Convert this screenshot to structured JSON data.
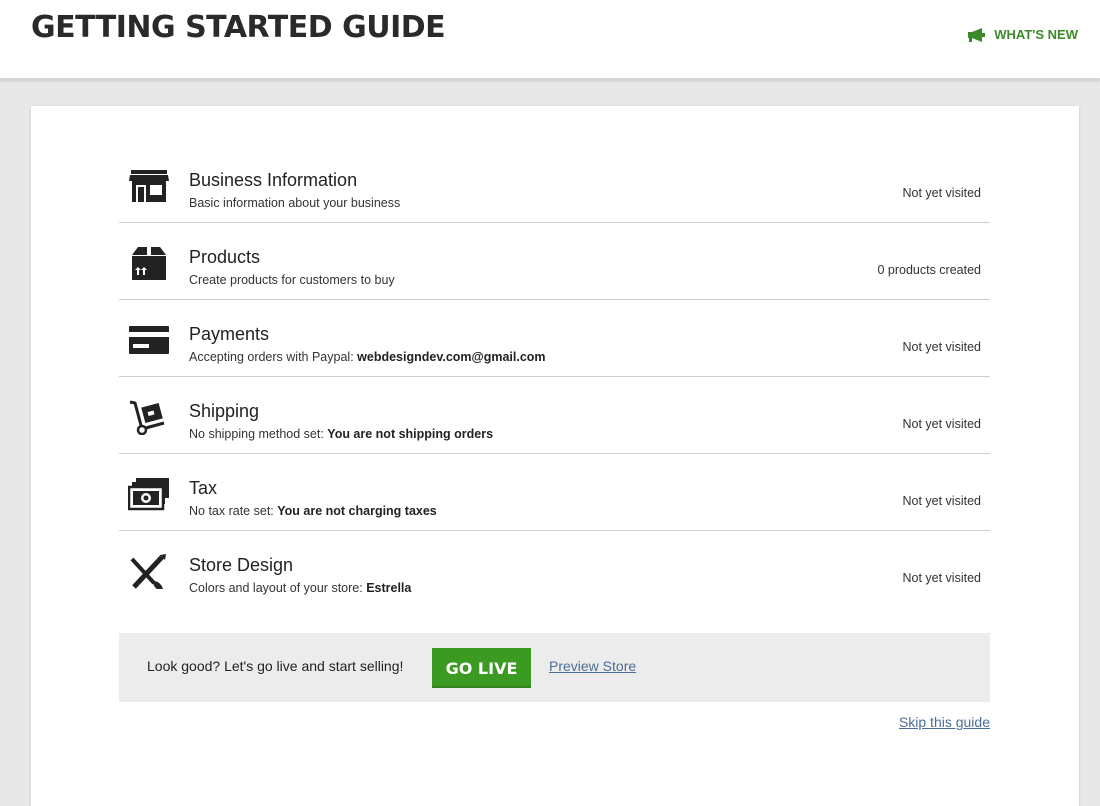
{
  "header": {
    "title": "GETTING STARTED GUIDE",
    "whats_new": "WHAT'S NEW"
  },
  "steps": [
    {
      "title": "Business Information",
      "desc": "Basic information about your business",
      "desc_bold": "",
      "status": "Not yet visited",
      "icon": "storefront-icon"
    },
    {
      "title": "Products",
      "desc": "Create products for customers to buy",
      "desc_bold": "",
      "status": "0 products created",
      "icon": "box-icon"
    },
    {
      "title": "Payments",
      "desc": "Accepting orders with Paypal: ",
      "desc_bold": "webdesigndev.com@gmail.com",
      "status": "Not yet visited",
      "icon": "credit-card-icon"
    },
    {
      "title": "Shipping",
      "desc": "No shipping method set: ",
      "desc_bold": "You are not shipping orders",
      "status": "Not yet visited",
      "icon": "hand-truck-icon"
    },
    {
      "title": "Tax",
      "desc": "No tax rate set: ",
      "desc_bold": "You are not charging taxes",
      "status": "Not yet visited",
      "icon": "money-icon"
    },
    {
      "title": "Store Design",
      "desc": "Colors and layout of your store: ",
      "desc_bold": "Estrella",
      "status": "Not yet visited",
      "icon": "brush-pencil-icon"
    }
  ],
  "golive": {
    "prompt": "Look good? Let's go live and start selling!",
    "button": "GO LIVE",
    "preview": "Preview Store"
  },
  "skip": "Skip this guide",
  "colors": {
    "accent_green": "#3a9a22",
    "link_blue": "#4a6e97"
  }
}
